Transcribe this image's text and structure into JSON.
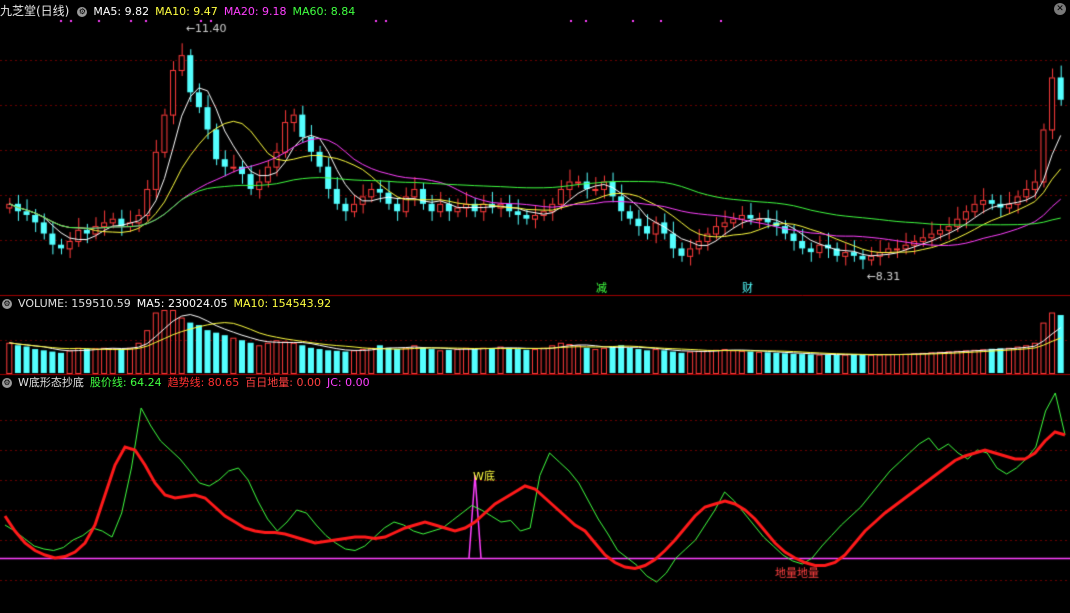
{
  "header": {
    "title": "九芝堂(日线)",
    "ma5": "MA5: 9.82",
    "ma10": "MA10: 9.47",
    "ma20": "MA20: 9.18",
    "ma60": "MA60: 8.84"
  },
  "volume_header": {
    "label": "VOLUME: 159510.59",
    "ma5": "MA5: 230024.05",
    "ma10": "MA10: 154543.92"
  },
  "indicator_header": {
    "name": "W底形态抄底",
    "gujia": "股价线: 64.24",
    "qushi": "趋势线: 80.65",
    "bairi": "百日地量: 0.00",
    "jc": "JC: 0.00"
  },
  "colors": {
    "up": "#ff3b3b",
    "down": "#54ffff",
    "ma5": "#ffffff",
    "ma10": "#ffff40",
    "ma20": "#ff40ff",
    "ma60": "#40ff40",
    "trend": "#ff1a1a",
    "jc": "#ff40ff",
    "grid": "#6a0000"
  },
  "icons": {
    "settings": "gear-icon",
    "close": "close-icon"
  },
  "chart_data": {
    "type": "candlestick",
    "price_range": [
      7.9,
      11.6
    ],
    "annotations": {
      "high": "11.40",
      "low": "8.31",
      "label_jian": "减",
      "label_cai": "财",
      "w_di": "W底",
      "di_liang": "地量地量"
    },
    "closes": [
      9.1,
      9.0,
      8.95,
      8.85,
      8.7,
      8.55,
      8.5,
      8.6,
      8.75,
      8.7,
      8.8,
      8.85,
      8.9,
      8.8,
      8.85,
      8.95,
      9.3,
      9.8,
      10.3,
      10.9,
      11.1,
      10.6,
      10.4,
      10.1,
      9.7,
      9.6,
      9.6,
      9.5,
      9.3,
      9.4,
      9.6,
      9.8,
      10.2,
      10.3,
      10.0,
      9.8,
      9.6,
      9.3,
      9.1,
      9.0,
      9.1,
      9.2,
      9.3,
      9.25,
      9.1,
      9.0,
      9.2,
      9.3,
      9.1,
      9.0,
      9.1,
      9.0,
      9.05,
      9.1,
      9.0,
      9.1,
      9.05,
      9.1,
      9.0,
      8.95,
      8.9,
      8.95,
      9.0,
      9.1,
      9.3,
      9.4,
      9.4,
      9.3,
      9.3,
      9.4,
      9.2,
      9.0,
      8.9,
      8.8,
      8.7,
      8.85,
      8.7,
      8.5,
      8.4,
      8.5,
      8.6,
      8.7,
      8.8,
      8.85,
      8.9,
      8.95,
      8.9,
      8.9,
      8.85,
      8.8,
      8.7,
      8.6,
      8.5,
      8.45,
      8.55,
      8.5,
      8.4,
      8.45,
      8.4,
      8.35,
      8.4,
      8.45,
      8.5,
      8.5,
      8.55,
      8.6,
      8.65,
      8.7,
      8.75,
      8.8,
      8.9,
      9.0,
      9.1,
      9.15,
      9.1,
      9.05,
      9.1,
      9.2,
      9.3,
      9.4,
      10.1,
      10.8,
      10.5
    ],
    "volumes": [
      120,
      110,
      105,
      95,
      90,
      85,
      80,
      90,
      100,
      95,
      98,
      100,
      98,
      95,
      100,
      120,
      170,
      240,
      250,
      250,
      220,
      200,
      190,
      170,
      160,
      150,
      140,
      130,
      120,
      110,
      120,
      130,
      125,
      120,
      110,
      100,
      95,
      90,
      88,
      85,
      90,
      95,
      100,
      110,
      100,
      95,
      100,
      110,
      100,
      95,
      90,
      92,
      95,
      100,
      95,
      100,
      98,
      105,
      100,
      95,
      92,
      95,
      100,
      110,
      120,
      115,
      110,
      100,
      95,
      100,
      105,
      110,
      100,
      95,
      90,
      95,
      90,
      85,
      80,
      85,
      88,
      90,
      92,
      95,
      90,
      88,
      85,
      84,
      82,
      80,
      78,
      76,
      75,
      74,
      73,
      72,
      72,
      73,
      74,
      72,
      72,
      73,
      74,
      75,
      76,
      78,
      80,
      82,
      84,
      86,
      88,
      90,
      92,
      94,
      96,
      98,
      100,
      105,
      110,
      120,
      200,
      240,
      230
    ],
    "gujia": [
      0.22,
      0.18,
      0.13,
      0.08,
      0.06,
      0.05,
      0.07,
      0.12,
      0.15,
      0.2,
      0.18,
      0.14,
      0.3,
      0.6,
      1.0,
      0.88,
      0.78,
      0.72,
      0.66,
      0.58,
      0.5,
      0.48,
      0.52,
      0.58,
      0.6,
      0.52,
      0.38,
      0.26,
      0.18,
      0.24,
      0.32,
      0.3,
      0.22,
      0.15,
      0.1,
      0.06,
      0.05,
      0.08,
      0.14,
      0.2,
      0.24,
      0.22,
      0.18,
      0.16,
      0.18,
      0.2,
      0.25,
      0.3,
      0.35,
      0.32,
      0.28,
      0.24,
      0.25,
      0.18,
      0.2,
      0.55,
      0.7,
      0.64,
      0.58,
      0.5,
      0.38,
      0.26,
      0.16,
      0.05,
      0.0,
      -0.05,
      -0.12,
      -0.16,
      -0.1,
      0.0,
      0.06,
      0.12,
      0.22,
      0.32,
      0.44,
      0.38,
      0.3,
      0.22,
      0.14,
      0.08,
      0.02,
      -0.02,
      -0.04,
      0.0,
      0.08,
      0.15,
      0.22,
      0.28,
      0.34,
      0.42,
      0.5,
      0.58,
      0.64,
      0.7,
      0.76,
      0.8,
      0.72,
      0.76,
      0.7,
      0.66,
      0.72,
      0.7,
      0.6,
      0.56,
      0.6,
      0.66,
      0.74,
      0.98,
      1.1,
      0.82
    ],
    "qushi": [
      0.28,
      0.18,
      0.1,
      0.05,
      0.02,
      0.0,
      0.01,
      0.04,
      0.1,
      0.22,
      0.42,
      0.62,
      0.74,
      0.72,
      0.62,
      0.5,
      0.42,
      0.4,
      0.41,
      0.42,
      0.4,
      0.34,
      0.28,
      0.24,
      0.2,
      0.18,
      0.17,
      0.17,
      0.16,
      0.14,
      0.12,
      0.1,
      0.11,
      0.12,
      0.13,
      0.14,
      0.14,
      0.13,
      0.14,
      0.17,
      0.2,
      0.22,
      0.24,
      0.22,
      0.2,
      0.18,
      0.2,
      0.24,
      0.3,
      0.36,
      0.4,
      0.44,
      0.48,
      0.46,
      0.4,
      0.34,
      0.28,
      0.22,
      0.18,
      0.1,
      0.02,
      -0.03,
      -0.06,
      -0.07,
      -0.05,
      -0.01,
      0.05,
      0.12,
      0.2,
      0.28,
      0.34,
      0.36,
      0.38,
      0.36,
      0.32,
      0.26,
      0.18,
      0.1,
      0.04,
      0.0,
      -0.03,
      -0.05,
      -0.05,
      -0.03,
      0.02,
      0.1,
      0.18,
      0.24,
      0.3,
      0.35,
      0.4,
      0.45,
      0.5,
      0.55,
      0.6,
      0.65,
      0.68,
      0.7,
      0.72,
      0.7,
      0.68,
      0.66,
      0.66,
      0.7,
      0.78,
      0.84,
      0.82
    ],
    "jc_peak_index": 47
  }
}
